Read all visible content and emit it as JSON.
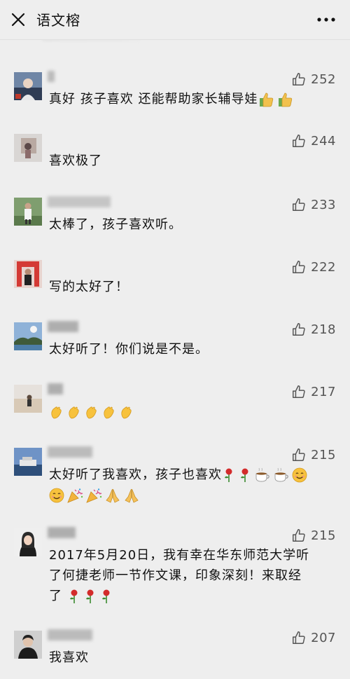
{
  "header": {
    "title": "语文榕",
    "close_icon": "close-icon",
    "more_icon": "more-icon"
  },
  "comments": [
    {
      "likes": "252",
      "text": "真好 孩子喜欢 还能帮助家长辅导娃"
    },
    {
      "likes": "244",
      "text": "喜欢极了"
    },
    {
      "likes": "233",
      "text": "太棒了，孩子喜欢听。"
    },
    {
      "likes": "222",
      "text": "写的太好了！"
    },
    {
      "likes": "218",
      "text": "太好听了！你们说是不是。"
    },
    {
      "likes": "217",
      "text": ""
    },
    {
      "likes": "215",
      "text": "太好听了我喜欢，孩子也喜欢"
    },
    {
      "likes": "215",
      "text_line1": "2017年5月20日，我有幸在华东师范大学听",
      "text_line2": "了何捷老师一节作文课，印象深刻！来取经",
      "text_line3": "了"
    },
    {
      "likes": "207",
      "text": "我喜欢"
    }
  ],
  "colors": {
    "background": "#eeeeee",
    "text": "#111111",
    "like": "#555555"
  }
}
